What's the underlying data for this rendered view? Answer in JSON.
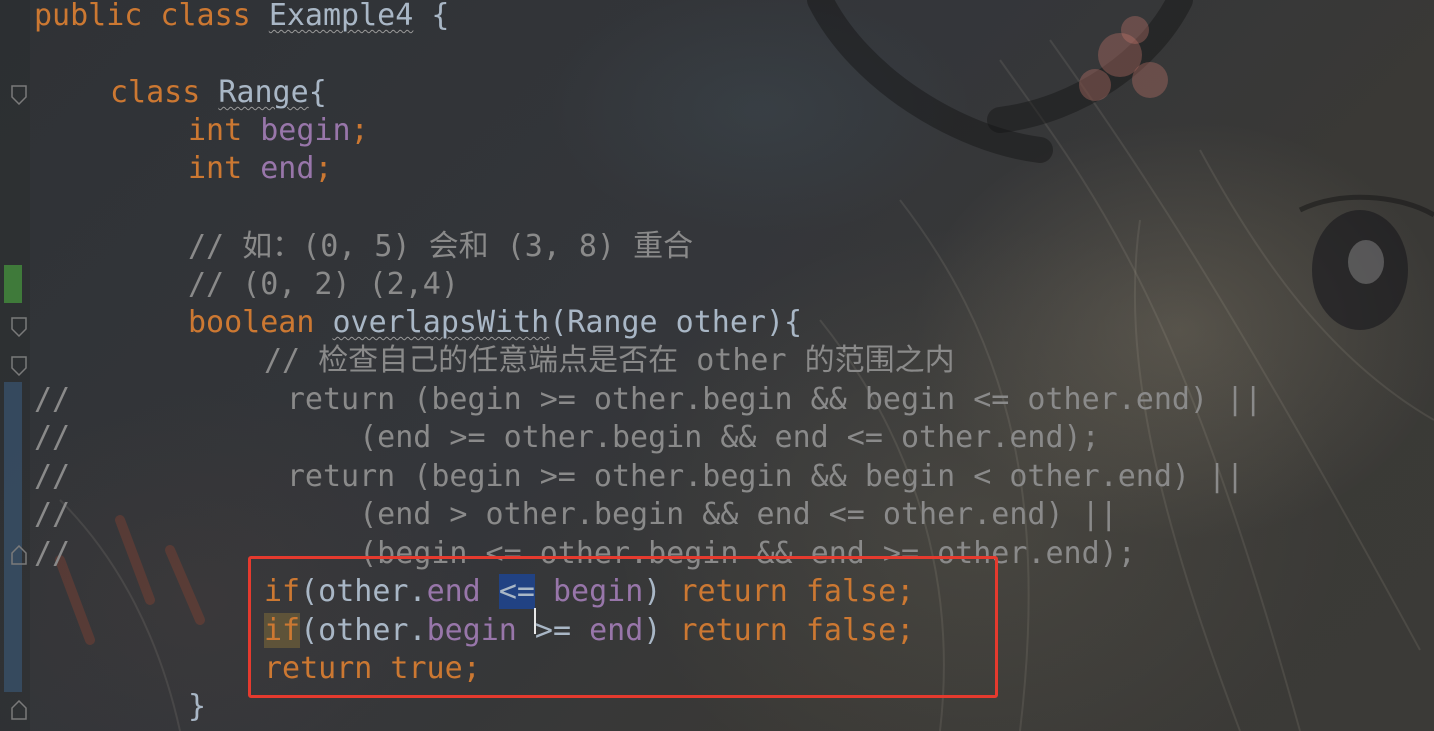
{
  "editor": {
    "colors": {
      "keyword": "#cc7832",
      "field": "#9876aa",
      "identifier": "#a9b7c6",
      "comment": "#8a8a8a",
      "selection": "#214283",
      "highlight_box": "#e53a2e"
    },
    "lines": {
      "l1": {
        "kw": "public class ",
        "name": "Example4",
        "brace": " {"
      },
      "l2": {
        "kw": "class ",
        "name": "Range",
        "brace": "{"
      },
      "l3": {
        "kw": "int ",
        "field": "begin",
        "semi": ";"
      },
      "l4": {
        "kw": "int ",
        "field": "end",
        "semi": ";"
      },
      "l5": {
        "comment": "// 如：(0, 5) 会和 (3, 8) 重合"
      },
      "l6": {
        "comment": "// (0, 2) (2,4)"
      },
      "l7": {
        "kw": "boolean ",
        "method": "overlapsWith",
        "params": "(Range other){"
      },
      "l8": {
        "comment": "// 检查自己的任意端点是否在 other 的范围之内"
      },
      "l9": {
        "comment": "//            return (begin >= other.begin && begin <= other.end) ||"
      },
      "l10": {
        "comment": "//                (end >= other.begin && end <= other.end);"
      },
      "l11": {
        "comment": "//            return (begin >= other.begin && begin < other.end) ||"
      },
      "l12": {
        "comment": "//                (end > other.begin && end <= other.end) ||"
      },
      "l13": {
        "comment": "//                (begin <= other.begin && end >= other.end);"
      },
      "l14": {
        "kw_if": "if",
        "open": "(other.",
        "field": "end",
        "sp": " ",
        "op": "<=",
        "sp2": " ",
        "field2": "begin",
        "close": ") ",
        "ret": "return false",
        "semi": ";"
      },
      "l15": {
        "kw_if": "if",
        "open": "(other.",
        "field": "begin",
        "op": " >= ",
        "field2": "end",
        "close": ") ",
        "ret": "return false",
        "semi": ";"
      },
      "l16": {
        "ret": "return true",
        "semi": ";"
      },
      "l17": {
        "brace": "}"
      }
    }
  }
}
